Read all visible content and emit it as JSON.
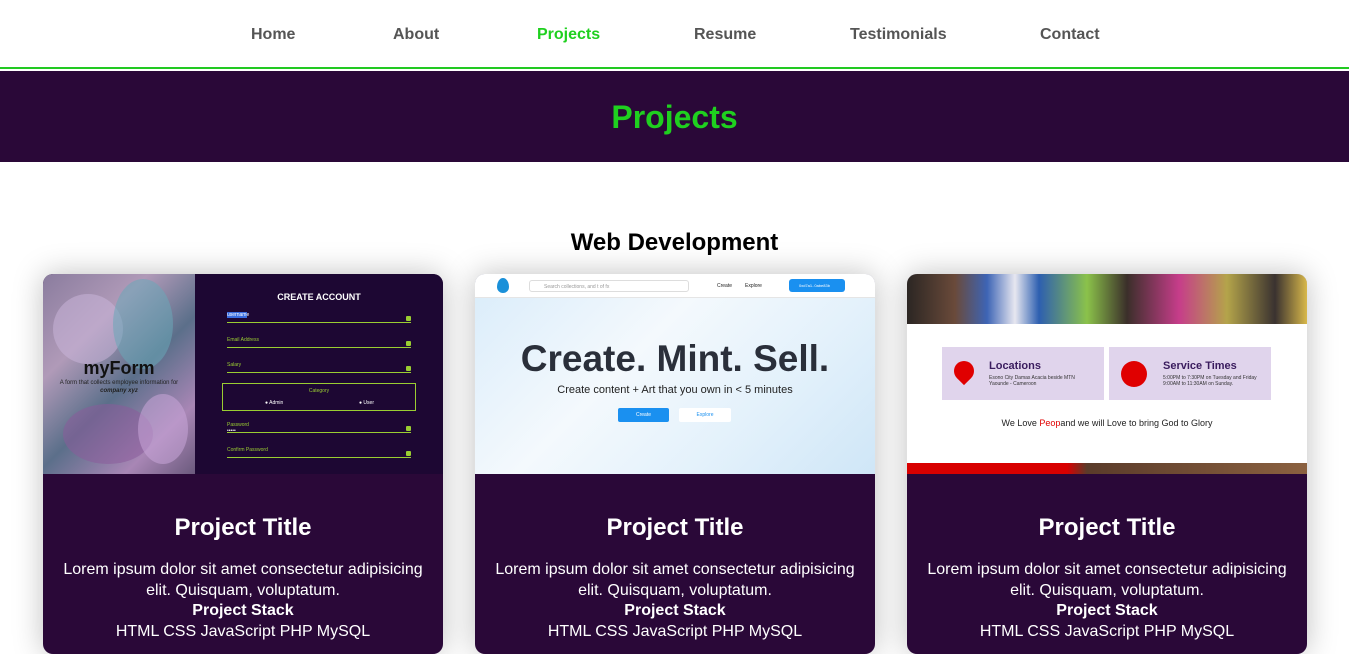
{
  "nav": {
    "items": [
      {
        "label": "Home"
      },
      {
        "label": "About"
      },
      {
        "label": "Projects",
        "active": true
      },
      {
        "label": "Resume"
      },
      {
        "label": "Testimonials"
      },
      {
        "label": "Contact"
      }
    ],
    "active_color": "#1fd01f"
  },
  "banner": {
    "title": "Projects",
    "background": "#2a0838"
  },
  "section": {
    "title": "Web Development"
  },
  "cards": [
    {
      "title": "Project Title",
      "description": "Lorem ipsum dolor sit amet consectetur adipisicing elit. Quisquam, voluptatum.",
      "stack_label": "Project Stack",
      "stack": "HTML CSS JavaScript PHP MySQL",
      "thumb": {
        "logo": "myForm",
        "subtitle": "A form that collects employee information for",
        "company": "company xyz",
        "heading": "CREATE ACCOUNT",
        "username": "username",
        "email": "Email Address",
        "salary": "Salary",
        "category": "Category",
        "admin": "Admin",
        "user": "User",
        "password": "Password",
        "password_dots": "•••••",
        "confirm": "Confirm Password"
      }
    },
    {
      "title": "Project Title",
      "description": "Lorem ipsum dolor sit amet consectetur adipisicing elit. Quisquam, voluptatum.",
      "stack_label": "Project Stack",
      "stack": "HTML CSS JavaScript PHP MySQL",
      "thumb": {
        "search_placeholder": "Search collections, and t of fx",
        "link_create": "Create",
        "link_explore": "Explore",
        "wallet": "0xd7a1..0abe83b",
        "tagline": "Create. Mint. Sell.",
        "subline": "Create content + Art that you own in < 5 minutes",
        "btn_create": "Create",
        "btn_explore": "Explore"
      }
    },
    {
      "title": "Project Title",
      "description": "Lorem ipsum dolor sit amet consectetur adipisicing elit. Quisquam, voluptatum.",
      "stack_label": "Project Stack",
      "stack": "HTML CSS JavaScript PHP MySQL",
      "thumb": {
        "locations_title": "Locations",
        "locations_text": "Esono City Damas Acacia beside MTN Yaounde - Cameroon",
        "service_title": "Service Times",
        "service_text": "5:00PM to 7:30PM on Tuesday and Friday 9:00AM to 11:30AM on Sunday.",
        "tagline_a": "We Love ",
        "tagline_red": "Peop",
        "tagline_b": "and we will Love to bring God to Glory"
      }
    }
  ]
}
